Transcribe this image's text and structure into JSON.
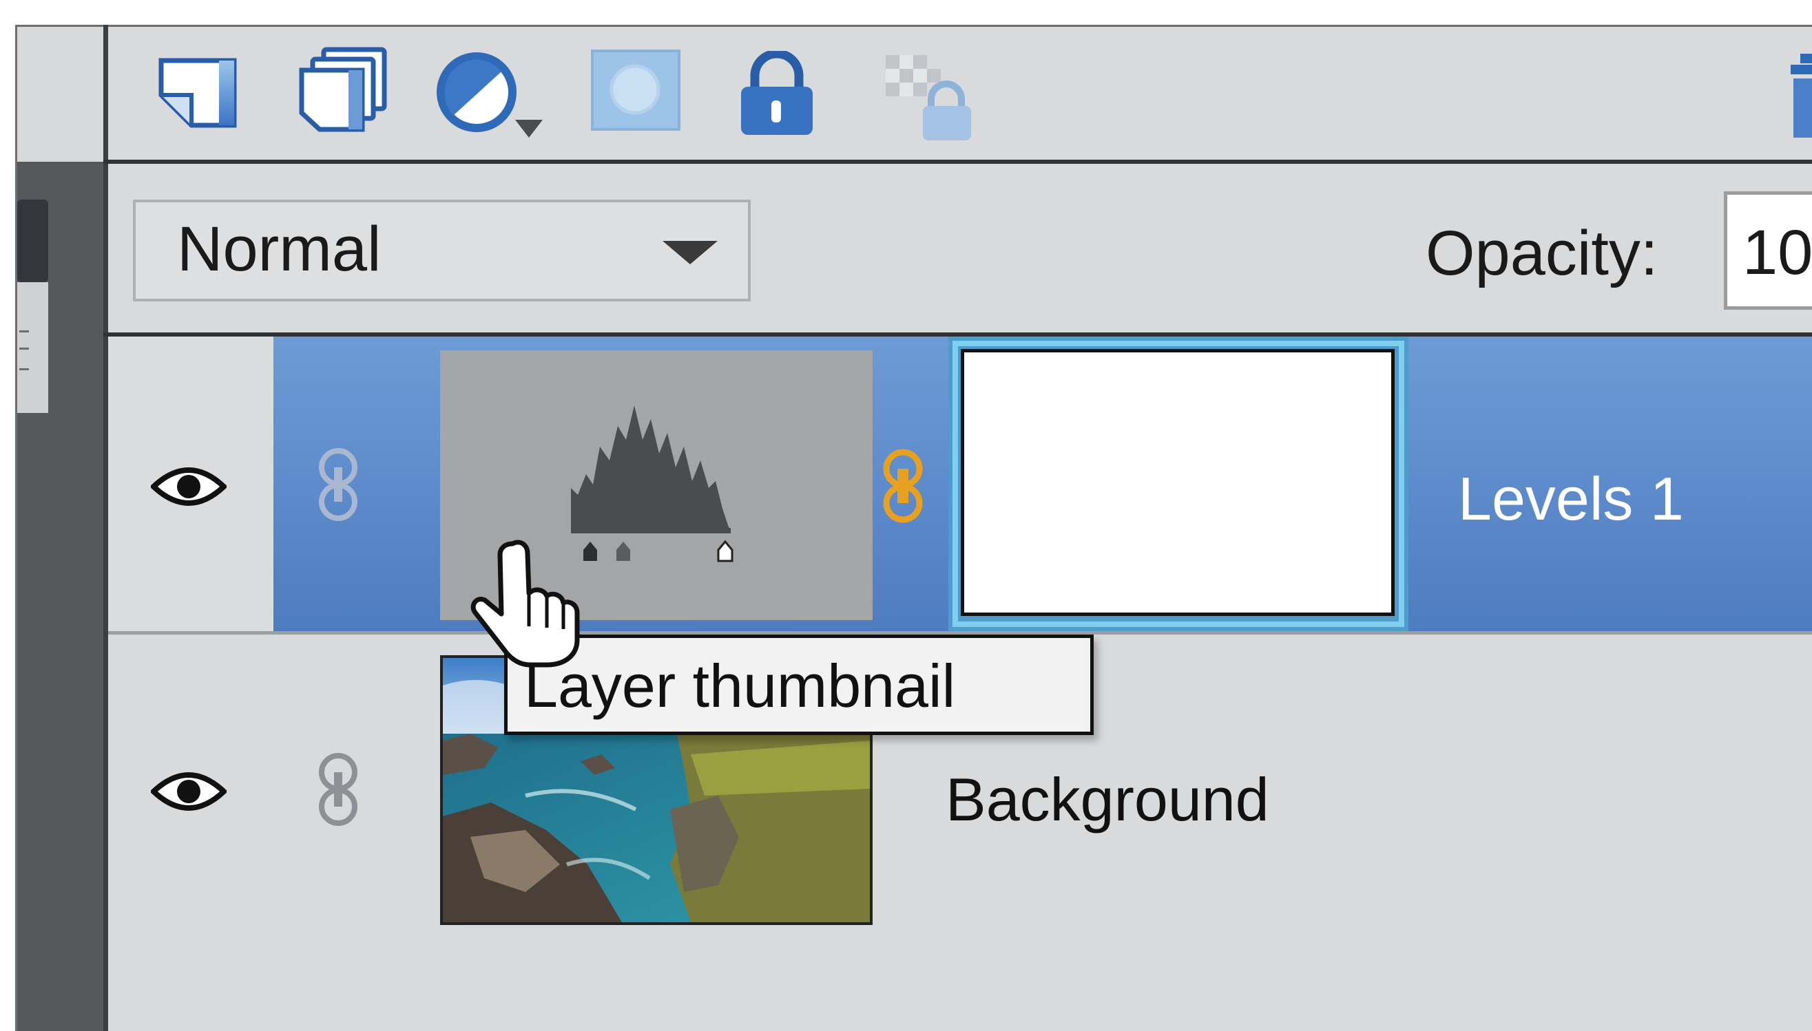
{
  "toolbar": {
    "icons": [
      "new-layer-icon",
      "new-group-icon",
      "adjustment-layer-icon",
      "layer-mask-icon",
      "lock-all-icon",
      "lock-transparency-icon",
      "delete-layer-icon"
    ]
  },
  "blend_mode": {
    "value": "Normal"
  },
  "opacity": {
    "label": "Opacity:",
    "value": "10"
  },
  "layers": [
    {
      "name": "Levels 1",
      "selected": true,
      "visible": true
    },
    {
      "name": "Background",
      "selected": false,
      "visible": true
    }
  ],
  "tooltip": {
    "text": "Layer thumbnail"
  },
  "colors": {
    "selection": "#5b88c9",
    "panel": "#d8dadb",
    "mask_highlight": "#7fd0ef",
    "link_active": "#e8a020"
  }
}
